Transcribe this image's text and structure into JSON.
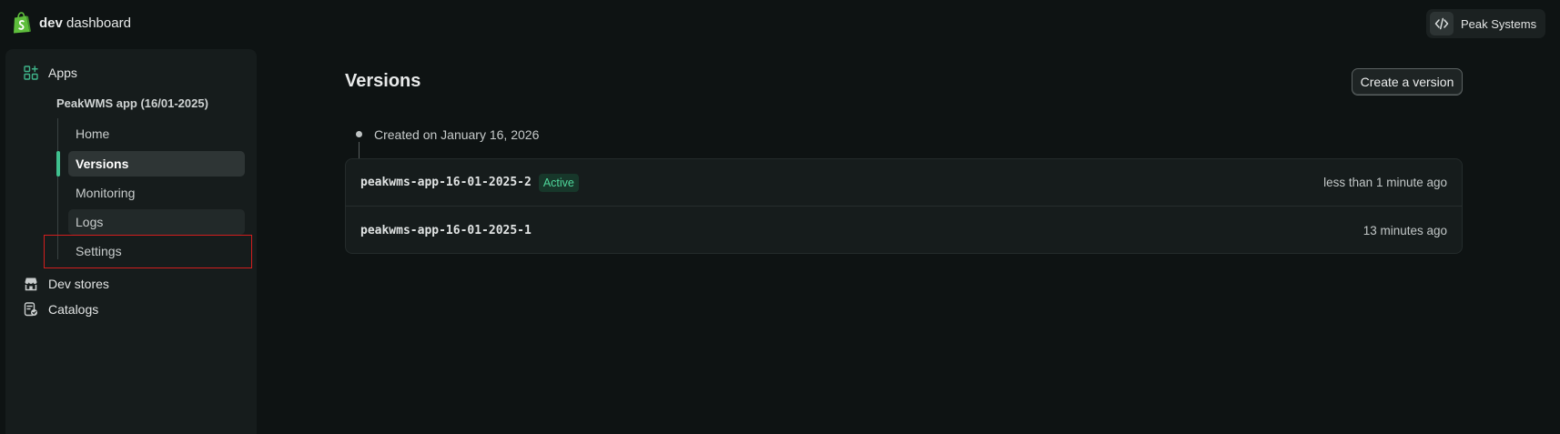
{
  "header": {
    "logo_bold": "dev",
    "logo_rest": "dashboard",
    "org_name": "Peak Systems"
  },
  "sidebar": {
    "apps_label": "Apps",
    "app_name": "PeakWMS app (16/01-2025)",
    "sub_items": [
      {
        "label": "Home"
      },
      {
        "label": "Versions"
      },
      {
        "label": "Monitoring"
      },
      {
        "label": "Logs"
      },
      {
        "label": "Settings"
      }
    ],
    "dev_stores_label": "Dev stores",
    "catalogs_label": "Catalogs"
  },
  "main": {
    "title": "Versions",
    "create_button": "Create a version",
    "timeline_label": "Created on January 16, 2026",
    "versions": [
      {
        "name": "peakwms-app-16-01-2025-2",
        "badge": "Active",
        "time": "less than 1 minute ago"
      },
      {
        "name": "peakwms-app-16-01-2025-1",
        "time": "13 minutes ago"
      }
    ]
  },
  "colors": {
    "background": "#0e1313",
    "sidebar": "#161c1c",
    "accent_green": "#3fc08e",
    "badge_text": "#4fd79b",
    "highlight_red": "#d21e1e"
  }
}
